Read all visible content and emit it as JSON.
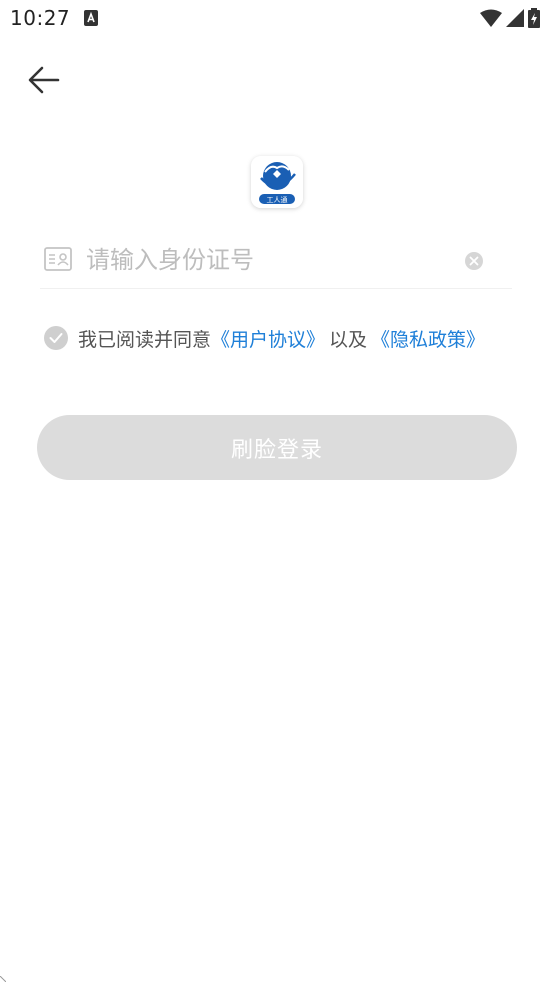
{
  "status_bar": {
    "time": "10:27",
    "icons": [
      "notification-a-icon",
      "wifi-icon",
      "signal-icon",
      "battery-charging-icon"
    ]
  },
  "header": {
    "back_icon": "arrow-left-icon"
  },
  "logo": {
    "icon": "app-logo-icon",
    "text": "工人通"
  },
  "id_field": {
    "icon": "id-card-icon",
    "placeholder": "请输入身份证号",
    "value": "",
    "clear_icon": "clear-circle-icon"
  },
  "agreement": {
    "checked": true,
    "prefix": "我已阅读并同意",
    "user_agreement": "《用户协议》",
    "connector": "以及",
    "privacy_policy": "《隐私政策》"
  },
  "login_button": {
    "label": "刷脸登录",
    "enabled": false
  },
  "colors": {
    "link": "#1e7fd8",
    "button_disabled": "#dcdcdc",
    "check_inactive": "#cfcfcf",
    "logo_blue": "#1a5fb4"
  }
}
